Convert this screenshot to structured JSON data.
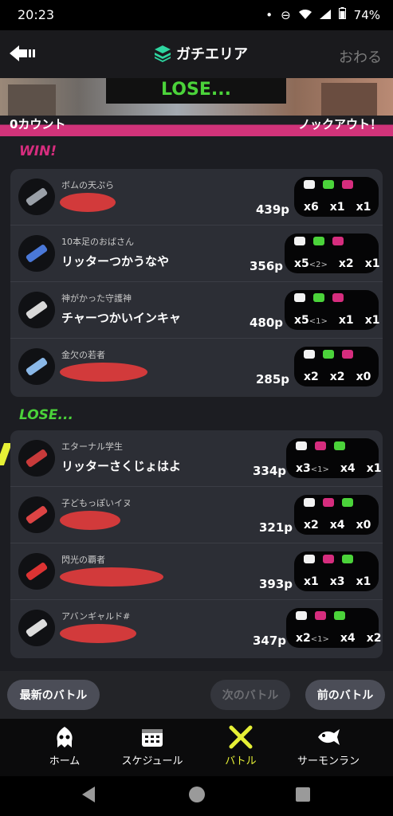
{
  "status": {
    "time": "20:23",
    "battery": "74%"
  },
  "header": {
    "title": "ガチエリア",
    "end_label": "おわる"
  },
  "banner": {
    "result": "LOSE...",
    "left_count": "0カウント",
    "right_label": "ノックアウト！"
  },
  "win_team": {
    "label": "WIN!",
    "players": [
      {
        "title": "ボムの天ぷら",
        "name": "",
        "score": "439p",
        "stats": [
          "x6",
          "x1",
          "x1"
        ],
        "sp": ""
      },
      {
        "title": "10本足のおばさん",
        "name": "リッターつかうなや",
        "score": "356p",
        "stats": [
          "x5",
          "x2",
          "x1"
        ],
        "sp": "<2>"
      },
      {
        "title": "神がかった守護神",
        "name": "チャーつかいインキャ",
        "score": "480p",
        "stats": [
          "x5",
          "x1",
          "x1"
        ],
        "sp": "<1>"
      },
      {
        "title": "金欠の若者",
        "name": "",
        "score": "285p",
        "stats": [
          "x2",
          "x2",
          "x0"
        ],
        "sp": ""
      }
    ]
  },
  "lose_team": {
    "label": "LOSE...",
    "players": [
      {
        "title": "エターナル学生",
        "name": "リッターさくじょはよ",
        "score": "334p",
        "stats": [
          "x3",
          "x4",
          "x1"
        ],
        "sp": "<1>"
      },
      {
        "title": "子どもっぽいイヌ",
        "name": "",
        "score": "321p",
        "stats": [
          "x2",
          "x4",
          "x0"
        ],
        "sp": ""
      },
      {
        "title": "閃光の覇者",
        "name": "",
        "score": "393p",
        "stats": [
          "x1",
          "x3",
          "x1"
        ],
        "sp": ""
      },
      {
        "title": "アバンギャルド#",
        "name": "",
        "score": "347p",
        "stats": [
          "x2",
          "x4",
          "x2"
        ],
        "sp": "<1>"
      }
    ]
  },
  "nav": {
    "latest": "最新のバトル",
    "next": "次のバトル",
    "prev": "前のバトル"
  },
  "tabs": [
    {
      "label": "ホーム",
      "icon": "squid-icon"
    },
    {
      "label": "スケジュール",
      "icon": "calendar-icon"
    },
    {
      "label": "バトル",
      "icon": "battle-icon"
    },
    {
      "label": "サーモンラン",
      "icon": "salmon-icon"
    }
  ],
  "colors": {
    "accent_pink": "#d62d7e",
    "accent_green": "#4bd33a",
    "active_tab": "#e6f036"
  }
}
